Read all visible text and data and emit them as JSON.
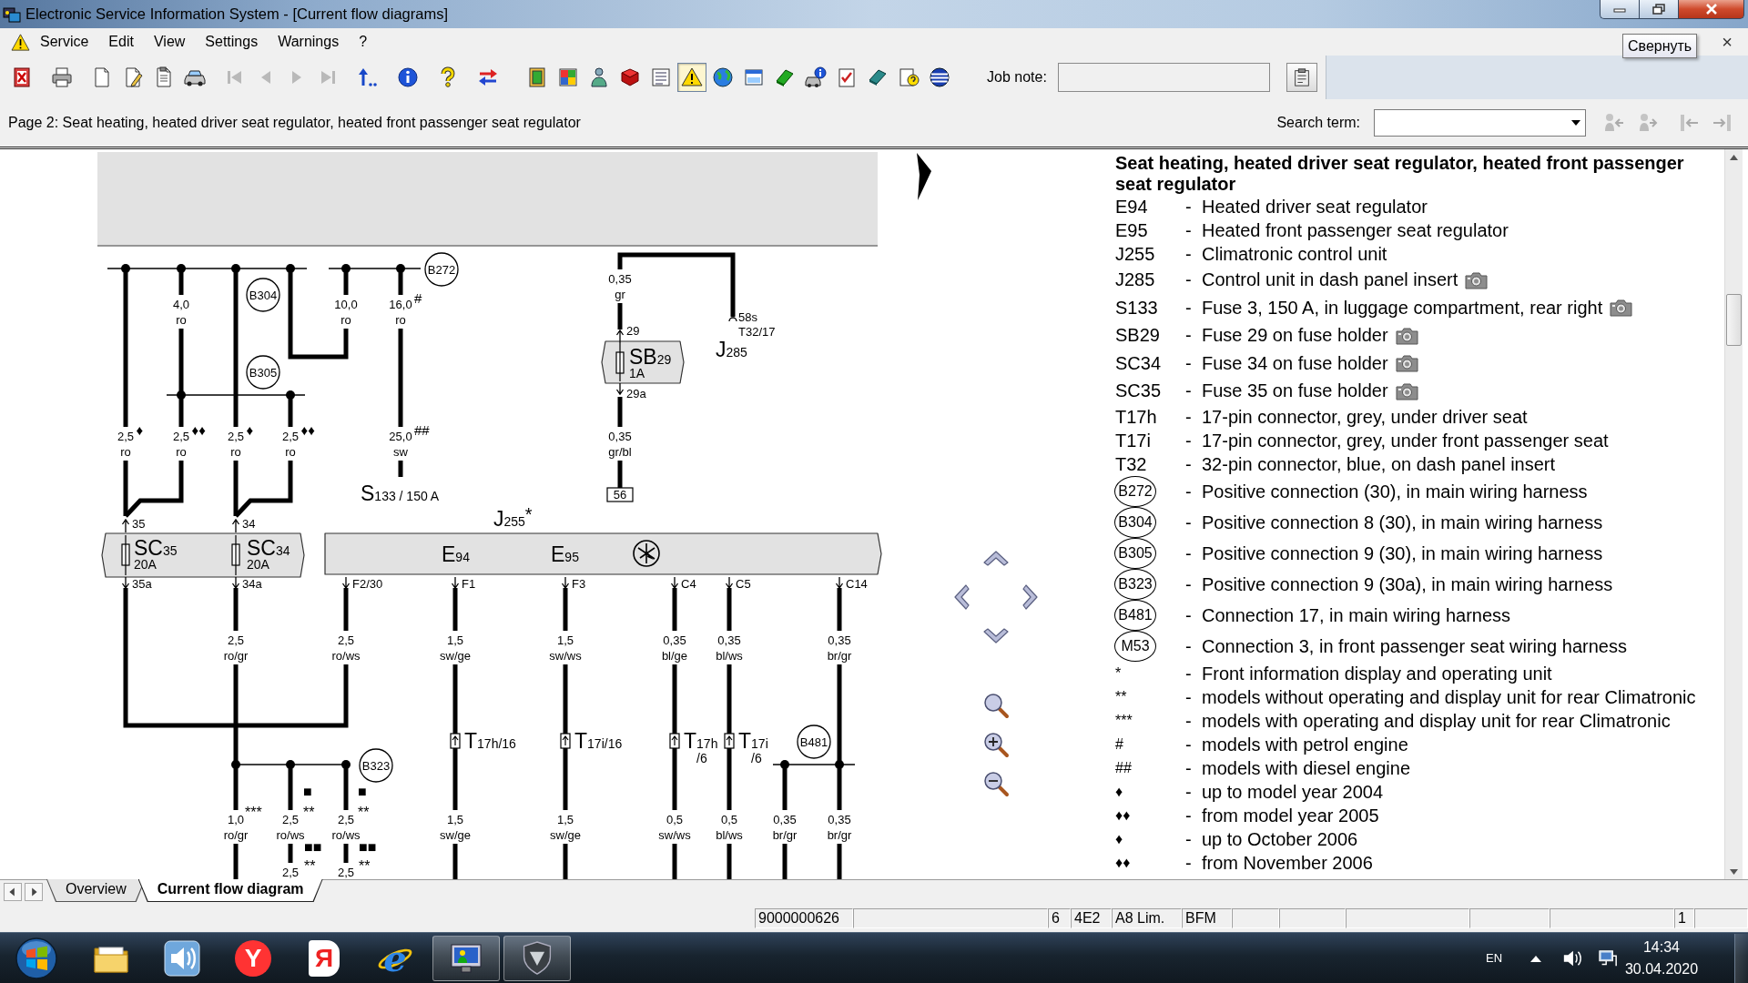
{
  "window": {
    "title": "Electronic Service Information System - [Current flow diagrams]"
  },
  "menu_bar": {
    "items": [
      {
        "label": "Service"
      },
      {
        "label": "Edit"
      },
      {
        "label": "View"
      },
      {
        "label": "Settings"
      },
      {
        "label": "Warnings"
      },
      {
        "label": "?"
      }
    ],
    "tooltip": "Свернуть",
    "close_glyph": "×"
  },
  "toolbar": {
    "groups": [
      [
        {
          "kind": "exit",
          "disabled": false,
          "pressed": false
        }
      ],
      [
        {
          "kind": "print",
          "disabled": false,
          "pressed": false
        }
      ],
      [
        {
          "kind": "new",
          "disabled": false,
          "pressed": false
        },
        {
          "kind": "edit",
          "disabled": false,
          "pressed": false
        },
        {
          "kind": "notes",
          "disabled": false,
          "pressed": false
        },
        {
          "kind": "vehicle",
          "disabled": false,
          "pressed": false
        }
      ],
      [
        {
          "kind": "first",
          "disabled": true,
          "pressed": false
        },
        {
          "kind": "previous",
          "disabled": true,
          "pressed": false
        },
        {
          "kind": "next",
          "disabled": true,
          "pressed": false
        },
        {
          "kind": "last",
          "disabled": true,
          "pressed": false
        }
      ],
      [
        {
          "kind": "back",
          "disabled": false,
          "pressed": false
        }
      ],
      [
        {
          "kind": "info",
          "disabled": false,
          "pressed": false
        }
      ],
      [
        {
          "kind": "hint",
          "disabled": false,
          "pressed": false
        }
      ],
      [
        {
          "kind": "swap",
          "disabled": false,
          "pressed": false
        }
      ],
      [
        {
          "kind": "document",
          "disabled": false,
          "pressed": false
        },
        {
          "kind": "grid",
          "disabled": false,
          "pressed": false
        },
        {
          "kind": "person",
          "disabled": false,
          "pressed": false
        },
        {
          "kind": "book",
          "disabled": false,
          "pressed": false
        },
        {
          "kind": "list",
          "disabled": false,
          "pressed": false
        },
        {
          "kind": "warning",
          "disabled": false,
          "pressed": true
        },
        {
          "kind": "globe",
          "disabled": false,
          "pressed": false
        },
        {
          "kind": "window",
          "disabled": false,
          "pressed": false
        },
        {
          "kind": "manual",
          "disabled": false,
          "pressed": false
        },
        {
          "kind": "diagnosis",
          "disabled": false,
          "pressed": false
        },
        {
          "kind": "checklist",
          "disabled": false,
          "pressed": false
        },
        {
          "kind": "tools",
          "disabled": false,
          "pressed": false
        },
        {
          "kind": "help",
          "disabled": false,
          "pressed": false
        },
        {
          "kind": "network",
          "disabled": false,
          "pressed": false
        }
      ]
    ],
    "job_note": {
      "label": "Job note:"
    }
  },
  "page_bar": {
    "title": "Page 2: Seat heating, heated driver seat regulator, heated front passenger seat regulator",
    "search": {
      "label": "Search term:"
    },
    "buttons": [
      {
        "kind": "findprev",
        "disabled": true
      },
      {
        "kind": "findnext",
        "disabled": true
      },
      {
        "kind": "jumpfirst",
        "disabled": true
      },
      {
        "kind": "jumplast",
        "disabled": true
      }
    ]
  },
  "diagram": {
    "connection_points": [
      "B272",
      "B304",
      "B305",
      "B323",
      "B481"
    ],
    "fuses": [
      {
        "name": "SC",
        "number": "35",
        "rating": "20A"
      },
      {
        "name": "SC",
        "number": "34",
        "rating": "20A"
      },
      {
        "name": "SB",
        "number": "29",
        "rating": "1A"
      }
    ],
    "main_fuse": {
      "name": "S",
      "number": "133 / 150 A"
    },
    "control_units": [
      {
        "name": "J",
        "number": "255",
        "note": "*"
      },
      {
        "name": "J",
        "number": "285"
      }
    ],
    "components": [
      {
        "name": "E",
        "number": "94"
      },
      {
        "name": "E",
        "number": "95"
      }
    ],
    "terminal": "56",
    "pins": [
      "35",
      "34",
      "29",
      "29a",
      "35a",
      "34a",
      "F2/30",
      "F1",
      "F3",
      "C4",
      "C5",
      "C14",
      "58s",
      "T32/17"
    ],
    "connectors": [
      {
        "name": "T",
        "number": "17h/16"
      },
      {
        "name": "T",
        "number": "17i/16"
      },
      {
        "name": "T",
        "number": "17h",
        "pin": "/6"
      },
      {
        "name": "T",
        "number": "17i",
        "pin": "/6"
      }
    ],
    "wire_labels": [
      {
        "size": "4,0",
        "insulation": "ro"
      },
      {
        "size": "10,0",
        "insulation": "ro"
      },
      {
        "size": "16,0",
        "insulation": "ro",
        "note": "#"
      },
      {
        "size": "0,35",
        "insulation": "gr"
      },
      {
        "size": "2,5",
        "insulation": "ro",
        "note": "♦"
      },
      {
        "size": "2,5",
        "insulation": "ro",
        "note": "♦♦"
      },
      {
        "size": "2,5",
        "insulation": "ro",
        "note": "♦"
      },
      {
        "size": "2,5",
        "insulation": "ro",
        "note": "♦♦"
      },
      {
        "size": "25,0",
        "insulation": "sw",
        "note": "##"
      },
      {
        "size": "0,35",
        "insulation": "gr/bl"
      },
      {
        "size": "2,5",
        "insulation": "ro/gr"
      },
      {
        "size": "2,5",
        "insulation": "ro/ws"
      },
      {
        "size": "1,5",
        "insulation": "sw/ge"
      },
      {
        "size": "1,5",
        "insulation": "sw/ws"
      },
      {
        "size": "0,35",
        "insulation": "bl/ge"
      },
      {
        "size": "0,35",
        "insulation": "bl/ws"
      },
      {
        "size": "0,35",
        "insulation": "br/gr"
      },
      {
        "size": "1,0",
        "insulation": "ro/gr"
      },
      {
        "size": "2,5",
        "insulation": "ro/ws"
      },
      {
        "size": "2,5",
        "insulation": "ro/ws"
      },
      {
        "size": "1,5",
        "insulation": "sw/ge"
      },
      {
        "size": "1,5",
        "insulation": "sw/ge"
      },
      {
        "size": "0,5",
        "insulation": "sw/ws"
      },
      {
        "size": "0,5",
        "insulation": "bl/ws"
      },
      {
        "size": "0,35",
        "insulation": "br/gr"
      },
      {
        "size": "0,35",
        "insulation": "br/gr"
      },
      {
        "size": "2,5"
      },
      {
        "size": "2,5"
      }
    ],
    "footnote_marks": [
      {
        "lines": [
          "***"
        ]
      },
      {
        "lines": [
          "■",
          "**"
        ]
      },
      {
        "lines": [
          "■",
          "**"
        ]
      },
      {
        "lines": [
          "■■",
          "**"
        ]
      },
      {
        "lines": [
          "■■",
          "**"
        ]
      }
    ]
  },
  "legend": {
    "title": "Seat heating, heated driver seat regulator, heated front passenger seat regulator",
    "entries": [
      {
        "kind": "code",
        "code": "E94",
        "dash": "-",
        "text": "Heated driver seat regulator",
        "photo": false
      },
      {
        "kind": "code",
        "code": "E95",
        "dash": "-",
        "text": "Heated front passenger seat regulator",
        "photo": false
      },
      {
        "kind": "code",
        "code": "J255",
        "dash": "-",
        "text": "Climatronic control unit",
        "photo": false
      },
      {
        "kind": "code",
        "code": "J285",
        "dash": "-",
        "text": "Control unit in dash panel insert",
        "photo": true
      },
      {
        "kind": "code",
        "code": "S133",
        "dash": "-",
        "text": "Fuse 3, 150 A, in luggage compartment, rear right",
        "photo": true
      },
      {
        "kind": "code",
        "code": "SB29",
        "dash": "-",
        "text": "Fuse 29 on fuse holder",
        "photo": true
      },
      {
        "kind": "code",
        "code": "SC34",
        "dash": "-",
        "text": "Fuse 34 on fuse holder",
        "photo": true
      },
      {
        "kind": "code",
        "code": "SC35",
        "dash": "-",
        "text": "Fuse 35 on fuse holder",
        "photo": true
      },
      {
        "kind": "code",
        "code": "T17h",
        "dash": "-",
        "text": "17-pin connector, grey, under driver seat",
        "photo": false
      },
      {
        "kind": "code",
        "code": "T17i",
        "dash": "-",
        "text": "17-pin connector, grey, under front passenger seat",
        "photo": false
      },
      {
        "kind": "code",
        "code": "T32",
        "dash": "-",
        "text": "32-pin connector, blue, on dash panel insert",
        "photo": false
      },
      {
        "kind": "connection",
        "code": "B272",
        "dash": "-",
        "text": "Positive connection (30), in main wiring harness",
        "photo": false
      },
      {
        "kind": "connection",
        "code": "B304",
        "dash": "-",
        "text": "Positive connection 8 (30), in main wiring harness",
        "photo": false
      },
      {
        "kind": "connection",
        "code": "B305",
        "dash": "-",
        "text": "Positive connection 9 (30), in main wiring harness",
        "photo": false
      },
      {
        "kind": "connection",
        "code": "B323",
        "dash": "-",
        "text": "Positive connection 9 (30a), in main wiring harness",
        "photo": false
      },
      {
        "kind": "connection",
        "code": "B481",
        "dash": "-",
        "text": "Connection 17, in main wiring harness",
        "photo": false
      },
      {
        "kind": "connection",
        "code": "M53",
        "dash": "-",
        "text": "Connection 3, in front passenger seat wiring harness",
        "photo": false
      },
      {
        "kind": "note",
        "code": "*",
        "dash": "-",
        "text": "Front information display and operating unit",
        "photo": false
      },
      {
        "kind": "note",
        "code": "**",
        "dash": "-",
        "text": "models without operating and display unit for rear Climatronic",
        "photo": false
      },
      {
        "kind": "note",
        "code": "***",
        "dash": "-",
        "text": "models with operating and display unit for rear Climatronic",
        "photo": false
      },
      {
        "kind": "note",
        "code": "#",
        "dash": "-",
        "text": "models with petrol engine",
        "photo": false
      },
      {
        "kind": "note",
        "code": "##",
        "dash": "-",
        "text": "models with diesel engine",
        "photo": false
      },
      {
        "kind": "note",
        "code": "♦",
        "dash": "-",
        "text": "up to model year 2004",
        "photo": false
      },
      {
        "kind": "note",
        "code": "♦♦",
        "dash": "-",
        "text": "from model year 2005",
        "photo": false
      },
      {
        "kind": "note",
        "code": "♦",
        "dash": "-",
        "text": "up to October 2006",
        "photo": false
      },
      {
        "kind": "note",
        "code": "♦♦",
        "dash": "-",
        "text": "from November 2006",
        "photo": false
      }
    ]
  },
  "sheet_tabs": [
    {
      "label": "Overview",
      "selected": false
    },
    {
      "label": "Current flow diagram",
      "selected": true
    }
  ],
  "status_bar": [
    "9000000626",
    "6",
    "4E2",
    "A8 Lim.",
    "BFM",
    "1"
  ],
  "taskbar": {
    "apps": [
      {
        "kind": "folder",
        "running": false
      },
      {
        "kind": "speaker",
        "running": false
      },
      {
        "kind": "browser",
        "glyph": "Y",
        "running": false
      },
      {
        "kind": "launcher",
        "glyph": "Я",
        "running": false
      },
      {
        "kind": "explorer",
        "glyph": "e",
        "running": false
      },
      {
        "kind": "esi",
        "running": true
      },
      {
        "kind": "tanks",
        "running": true
      }
    ],
    "language": "EN",
    "clock": {
      "time": "14:34",
      "date": "30.04.2020"
    }
  }
}
